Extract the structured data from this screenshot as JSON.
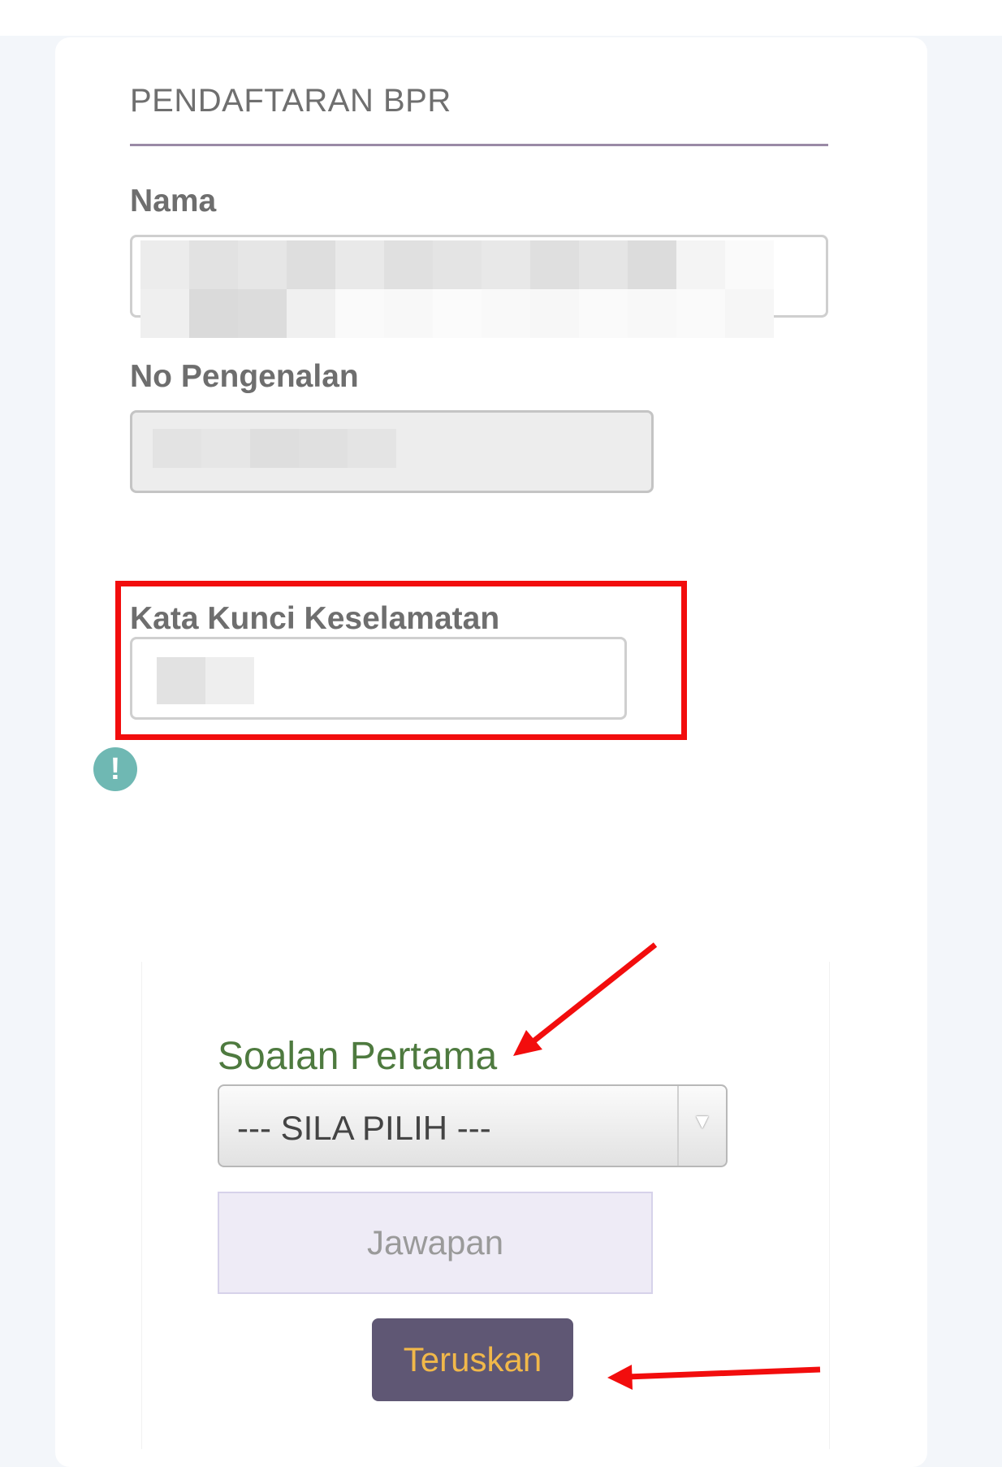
{
  "form": {
    "title": "PENDAFTARAN BPR",
    "name_label": "Nama",
    "id_label": "No Pengenalan",
    "security_label": "Kata Kunci Keselamatan",
    "alert_glyph": "!"
  },
  "security_question": {
    "label": "Soalan Pertama",
    "select_value": "--- SILA PILIH ---",
    "answer_placeholder": "Jawapan",
    "submit_label": "Teruskan"
  },
  "colors": {
    "title_rule": "#9a8aa6",
    "question_label": "#4e7a3f",
    "button_bg": "#5f5774",
    "button_text": "#f1b84a",
    "annotation_red": "#f20d0d",
    "alert_icon": "#6fb8b3"
  },
  "icons": {
    "alert": "exclamation-circle-icon",
    "dropdown": "triangle-down-icon"
  }
}
